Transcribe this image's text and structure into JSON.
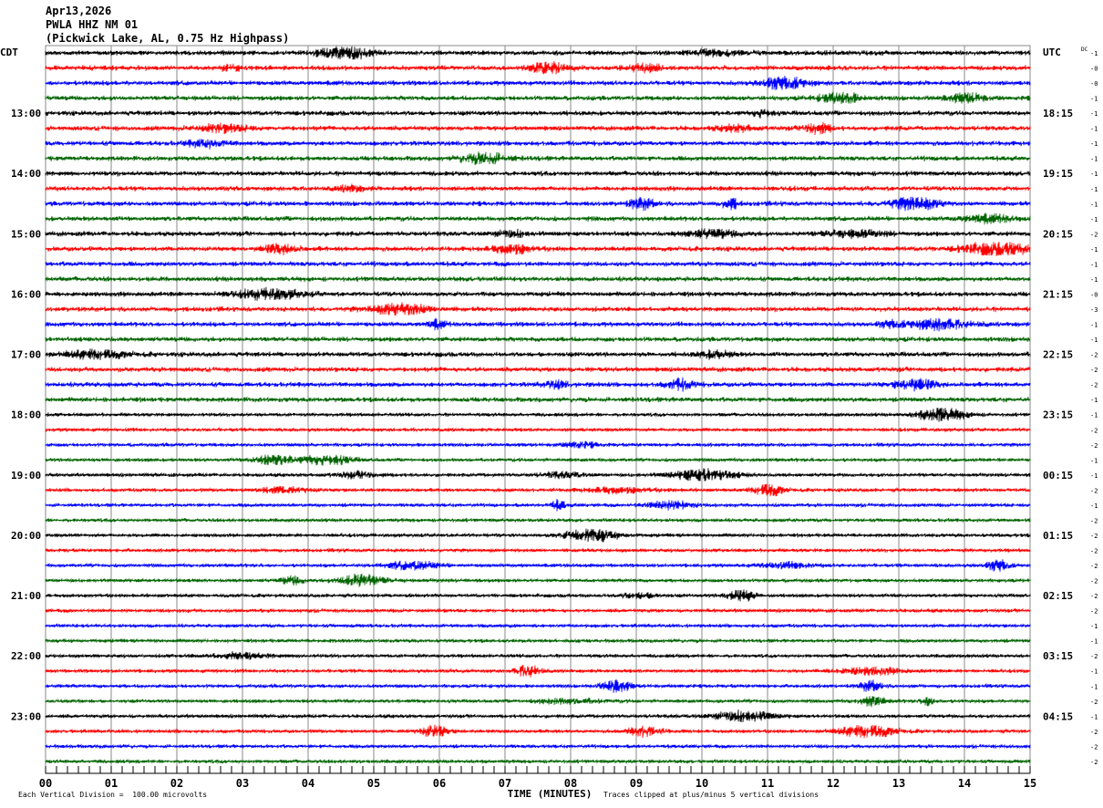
{
  "header": {
    "date": "Apr13,2026",
    "station": "PWLA HHZ NM 01",
    "location": "(Pickwick Lake, AL, 0.75 Hz Highpass)"
  },
  "chart_data": {
    "type": "line",
    "subtype": "helicorder",
    "left_axis_label": "CDT",
    "right_axis_label": "UTC",
    "dc_label": "DC",
    "xlabel": "TIME (MINUTES)",
    "xlim": [
      0,
      15
    ],
    "x_ticks": [
      "00",
      "01",
      "02",
      "03",
      "04",
      "05",
      "06",
      "07",
      "08",
      "09",
      "10",
      "11",
      "12",
      "13",
      "14",
      "15"
    ],
    "minor_tick_seconds": 10,
    "grid": true,
    "trace_colors": [
      "#000000",
      "#ff0000",
      "#0000ff",
      "#006400"
    ],
    "left_hour_labels": [
      "13:00",
      "14:00",
      "15:00",
      "16:00",
      "17:00",
      "18:00",
      "19:00",
      "20:00",
      "21:00",
      "22:00",
      "23:00"
    ],
    "right_hour_labels": [
      "18:15",
      "19:15",
      "20:15",
      "21:15",
      "22:15",
      "23:15",
      "00:15",
      "01:15",
      "02:15",
      "03:15",
      "04:15"
    ],
    "dc_offsets": [
      "-1",
      "-0",
      "-0",
      "-1",
      "-1",
      "-1",
      "-1",
      "-1",
      "-1",
      "-1",
      "-1",
      "-1",
      "-2",
      "-1",
      "-1",
      "-1",
      "-0",
      "-3",
      "-1",
      "-1",
      "-2",
      "-2",
      "-2",
      "-1",
      "-1",
      "-2",
      "-2",
      "-1",
      "-1",
      "-2",
      "-1",
      "-2",
      "-2",
      "-2",
      "-2",
      "-2",
      "-2",
      "-2",
      "-1",
      "-1",
      "-2",
      "-1",
      "-1",
      "-2",
      "-1",
      "-2",
      "-2",
      "-2"
    ]
  },
  "footer": {
    "scale_note": "Each Vertical Division =  100.00 microvolts",
    "clip_note": "Traces clipped at plus/minus 5 vertical divisions"
  }
}
